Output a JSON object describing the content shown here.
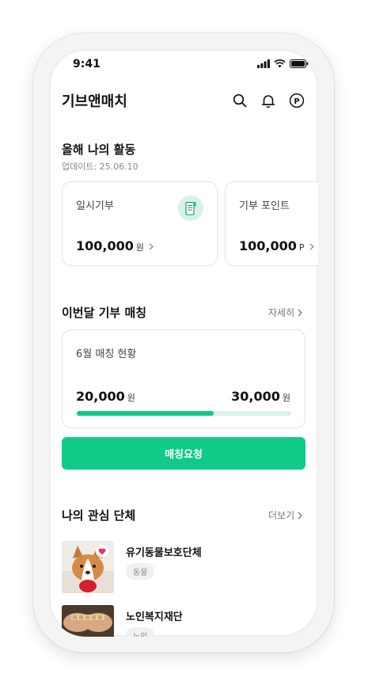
{
  "status": {
    "time": "9:41"
  },
  "header": {
    "title": "기브앤매치",
    "search_icon": "search-icon",
    "bell_icon": "bell-icon",
    "point_icon": "P"
  },
  "activity": {
    "title": "올해 나의 활동",
    "updated": "업데이트: 25.06.10",
    "cards": [
      {
        "label": "일시기부",
        "amount": "100,000",
        "unit": "원"
      },
      {
        "label": "기부 포인트",
        "amount": "100,000",
        "unit": "P"
      }
    ]
  },
  "matching": {
    "title": "이번달 기부 매칭",
    "more_label": "자세히",
    "card_label": "6월 매칭 현황",
    "current_amount": "20,000",
    "current_unit": "원",
    "target_amount": "30,000",
    "target_unit": "원",
    "progress": 0.64,
    "cta_label": "매칭요청"
  },
  "interests": {
    "title": "나의 관심 단체",
    "more_label": "더보기",
    "orgs": [
      {
        "name": "유기동물보호단체",
        "tag": "동물"
      },
      {
        "name": "노인복지재단",
        "tag": "노인"
      }
    ]
  },
  "colors": {
    "accent": "#10ca88",
    "accent_light": "#d9f3ea",
    "heart": "#f0305a"
  }
}
